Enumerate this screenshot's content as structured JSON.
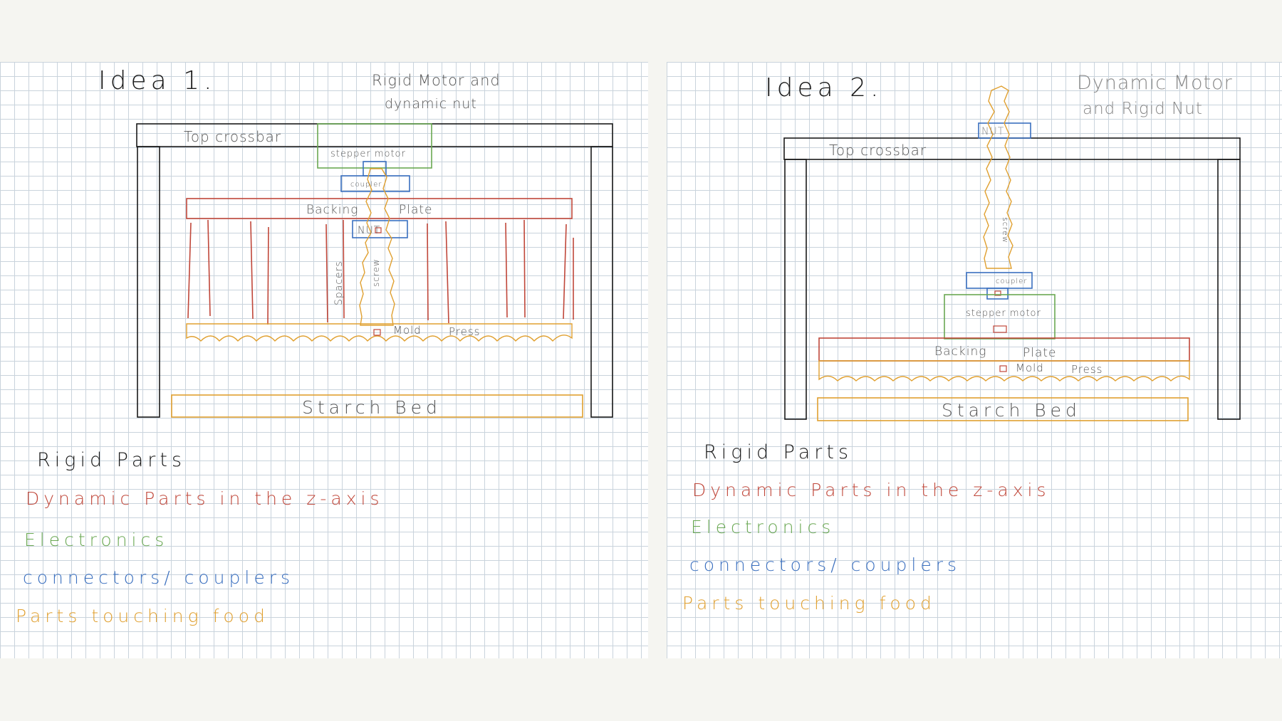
{
  "colors": {
    "rigid": "#1a1a1a",
    "dynamic": "#c0473a",
    "electronics": "#6aa853",
    "connectors": "#3a6fbf",
    "food": "#e0a030"
  },
  "idea1": {
    "title": "Idea 1.",
    "subtitle_line1": "Rigid Motor and",
    "subtitle_line2": "dynamic nut",
    "top_crossbar": "Top crossbar",
    "stepper_motor": "stepper motor",
    "coupler": "coupler",
    "backing": "Backing",
    "plate": "Plate",
    "nut": "NUT",
    "spacers": "Spacers",
    "screw": "screw",
    "mold": "Mold",
    "press": "Press",
    "starch_bed": "Starch Bed"
  },
  "idea2": {
    "title": "Idea 2.",
    "subtitle_line1": "Dynamic Motor",
    "subtitle_line2": "and Rigid Nut",
    "top_crossbar": "Top crossbar",
    "nut": "NUT",
    "screw": "screw",
    "coupler": "coupler",
    "stepper_motor": "stepper motor",
    "backing": "Backing",
    "plate": "Plate",
    "mold": "Mold",
    "press": "Press",
    "starch_bed": "Starch Bed"
  },
  "legend": {
    "rigid": "Rigid Parts",
    "dynamic": "Dynamic Parts in the z-axis",
    "electronics": "Electronics",
    "connectors": "connectors/ couplers",
    "food": "Parts touching food"
  }
}
